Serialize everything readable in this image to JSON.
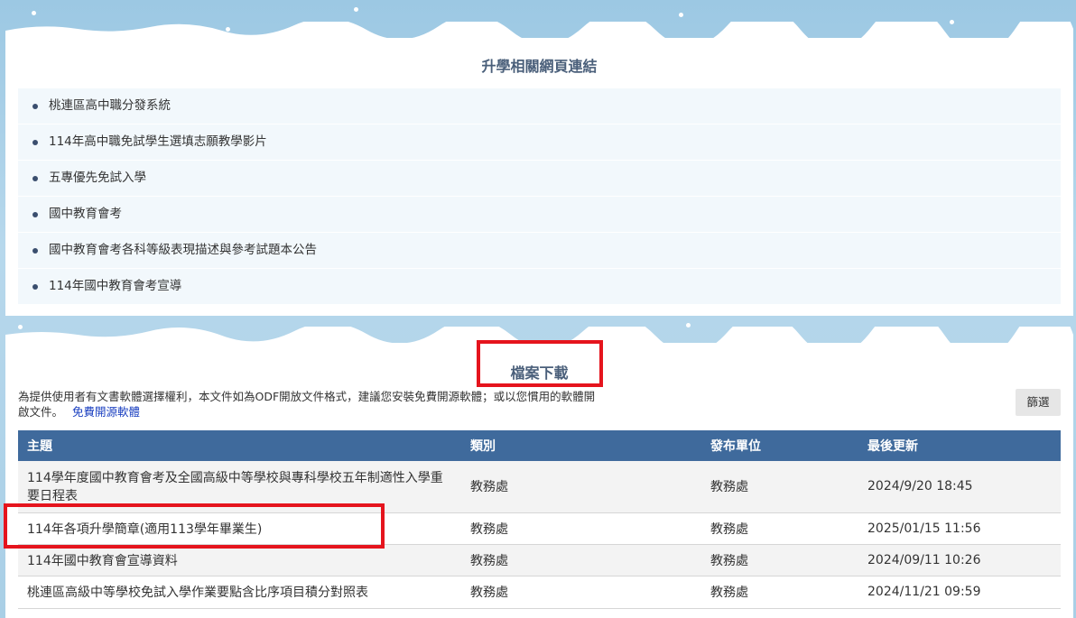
{
  "links_section": {
    "title": "升學相關網頁連結",
    "items": [
      "桃連區高中職分發系統",
      "114年高中職免試學生選填志願教學影片",
      "五專優先免試入學",
      "國中教育會考",
      "國中教育會考各科等級表現描述與參考試題本公告",
      "114年國中教育會考宣導"
    ]
  },
  "files_section": {
    "title": "檔案下載",
    "notice": "為提供使用者有文書軟體選擇權利，本文件如為ODF開放文件格式，建議您安裝免費開源軟體；或以您慣用的軟體開啟文件。",
    "notice_link": "免費開源軟體",
    "filter_label": "篩選",
    "columns": [
      "主題",
      "類別",
      "發布單位",
      "最後更新"
    ],
    "rows": [
      {
        "subject": "114學年度國中教育會考及全國高級中等學校與專科學校五年制適性入學重要日程表",
        "category": "教務處",
        "unit": "教務處",
        "updated": "2024/9/20 18:45"
      },
      {
        "subject": "114年各項升學簡章(適用113學年畢業生)",
        "category": "教務處",
        "unit": "教務處",
        "updated": "2025/01/15 11:56"
      },
      {
        "subject": "114年國中教育會宣導資料",
        "category": "教務處",
        "unit": "教務處",
        "updated": "2024/09/11 10:26"
      },
      {
        "subject": "桃連區高級中等學校免試入學作業要點含比序項目積分對照表",
        "category": "教務處",
        "unit": "教務處",
        "updated": "2024/11/21 09:59"
      }
    ]
  },
  "colors": {
    "header_bg": "#3f6a9c",
    "highlight": "#e5141d",
    "link": "#1a3fc0"
  }
}
